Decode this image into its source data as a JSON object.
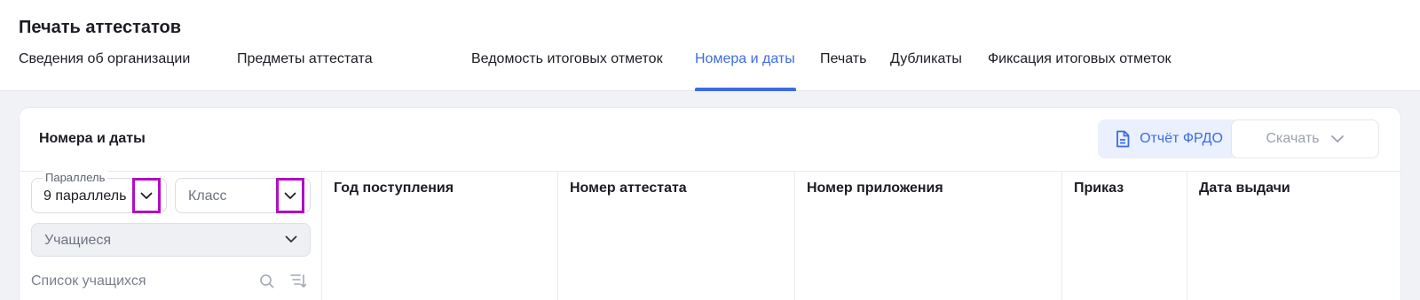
{
  "page": {
    "title": "Печать аттестатов"
  },
  "tabs": [
    {
      "label": "Сведения об организации",
      "active": false
    },
    {
      "label": "Предметы аттестата",
      "active": false
    },
    {
      "label": "Ведомость итоговых отметок",
      "active": false
    },
    {
      "label": "Номера и даты",
      "active": true
    },
    {
      "label": "Печать",
      "active": false
    },
    {
      "label": "Дубликаты",
      "active": false
    },
    {
      "label": "Фиксация итоговых отметок",
      "active": false
    }
  ],
  "card": {
    "title": "Номера и даты",
    "report_button": {
      "label": "Отчёт ФРДО",
      "icon": "document-icon"
    },
    "download_button": {
      "label": "Скачать",
      "icon": "chevron-down-icon"
    }
  },
  "filters": {
    "parallel": {
      "label": "Параллель",
      "value": "9 параллель"
    },
    "class": {
      "placeholder": "Класс"
    },
    "students": {
      "placeholder": "Учащиеся"
    },
    "search": {
      "placeholder": "Список учащихся",
      "value": ""
    }
  },
  "table": {
    "columns": [
      "Год поступления",
      "Номер аттестата",
      "Номер приложения",
      "Приказ",
      "Дата выдачи"
    ]
  },
  "colors": {
    "accent": "#3d6be6",
    "highlight": "#b10dc4",
    "background": "#f1f2f6"
  }
}
